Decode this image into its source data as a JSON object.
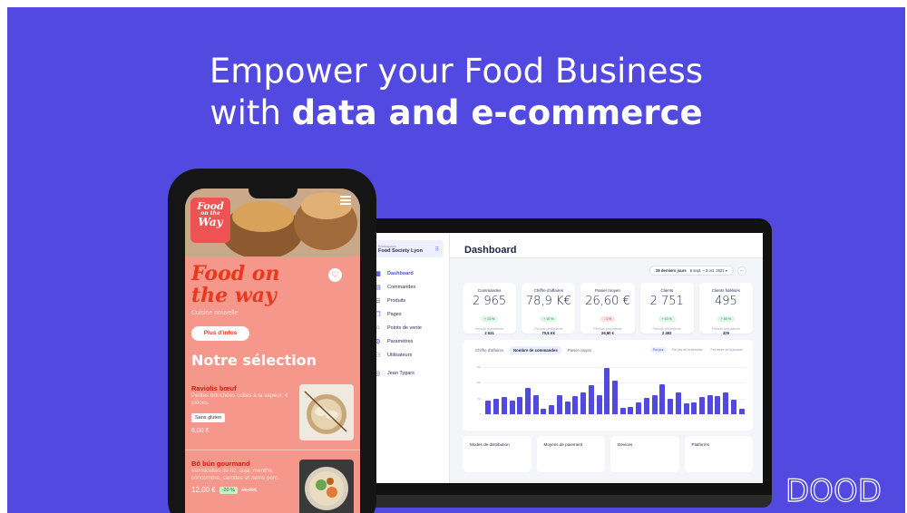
{
  "headline": {
    "line1": "Empower your Food Business",
    "line2_prefix": "with ",
    "line2_bold": "data and e-commerce"
  },
  "dashboard": {
    "workspace_label": "Workspace",
    "workspace_name": "Food Society Lyon",
    "nav": [
      {
        "label": "Dashboard",
        "icon": "grid-icon"
      },
      {
        "label": "Commandes",
        "icon": "orders-icon"
      },
      {
        "label": "Produits",
        "icon": "list-icon"
      },
      {
        "label": "Pages",
        "icon": "pages-icon"
      },
      {
        "label": "Points de vente",
        "icon": "store-icon"
      },
      {
        "label": "Paramètres",
        "icon": "gear-icon"
      },
      {
        "label": "Utilisateurs",
        "icon": "users-icon"
      }
    ],
    "user": "Jean Tygars",
    "title": "Dashboard",
    "range_label": "28 derniers jours",
    "range_dates": "6 sept. – 3 oct. 2021",
    "kpis": [
      {
        "label": "Commandes",
        "value": "2 965",
        "delta": "+ 13 %",
        "prev_label": "Période précédente",
        "prev": "2 631",
        "trend": "up"
      },
      {
        "label": "Chiffre d'affaires",
        "value": "78,9 K€",
        "delta": "+ 10 %",
        "prev_label": "Période précédente",
        "prev": "70,8 K€",
        "trend": "up"
      },
      {
        "label": "Panier moyen",
        "value": "26,60 €",
        "delta": "- 1 %",
        "prev_label": "Période précédente",
        "prev": "26,90 €",
        "trend": "down"
      },
      {
        "label": "Clients",
        "value": "2 751",
        "delta": "+ 10 %",
        "prev_label": "Période précédente",
        "prev": "2 492",
        "trend": "up"
      },
      {
        "label": "Clients fidélisés",
        "value": "495",
        "delta": "+ 60 %",
        "prev_label": "Période précédente",
        "prev": "329",
        "trend": "up"
      }
    ],
    "chart_tabs": [
      "Chiffre d'affaires",
      "Nombre de commandes",
      "Panier moyen"
    ],
    "chart_modes": [
      "Par jour",
      "Par jour de la semaine",
      "Par heure de la journée"
    ],
    "y_ticks": [
      "150",
      "100",
      "50",
      "0"
    ],
    "bars": [
      42,
      48,
      55,
      44,
      56,
      85,
      60,
      18,
      30,
      60,
      40,
      58,
      70,
      92,
      62,
      148,
      108,
      20,
      22,
      38,
      52,
      62,
      94,
      48,
      68,
      34,
      38,
      56,
      60,
      58,
      68,
      46,
      18
    ],
    "mini_cards": [
      "Modes de distribution",
      "Moyens de paiement",
      "Devices",
      "Platforms"
    ]
  },
  "phone": {
    "logo": {
      "l1": "Food",
      "l2": "on the",
      "l3": "Way"
    },
    "brand_title": "Food on the way",
    "subtitle": "Cuisine nouvelle",
    "more_button": "Plus d'infos",
    "section": "Notre sélection",
    "item1": {
      "name": "Raviolis bœuf",
      "desc": "Petites bouchées cuites à la vapeur, 4 pièces.",
      "tag": "Sans gluten",
      "price": "8,00 €"
    },
    "item2": {
      "name": "Bô bún gourmand",
      "desc": "Vermicelles de riz, soja, menthe, concombre, carottes et nems porc.",
      "price": "12,00 €",
      "discount": "-20 %",
      "old_price": "15,00€"
    }
  },
  "brand": {
    "name": "DOOD"
  },
  "colors": {
    "background": "#5149e0",
    "accent": "#5149e0",
    "phone_bg": "#f5978a",
    "brand_red": "#e8391e"
  }
}
